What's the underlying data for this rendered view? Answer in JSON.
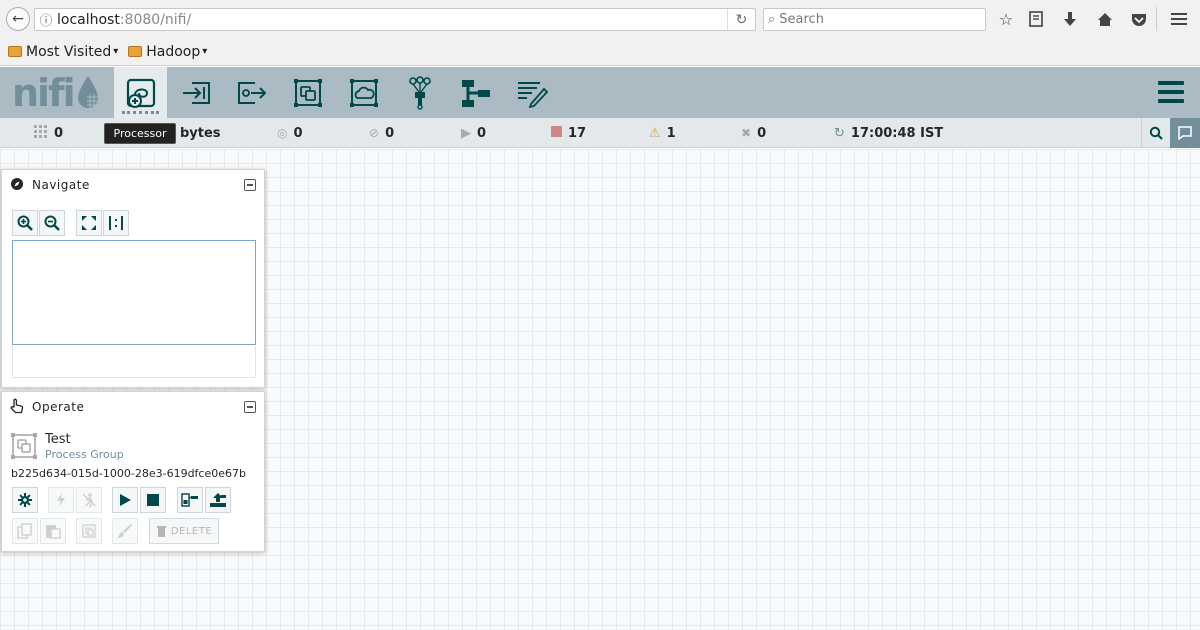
{
  "browser": {
    "url_host": "localhost",
    "url_rest": ":8080/nifi/",
    "search_placeholder": "Search",
    "bookmarks": [
      {
        "label": "Most Visited"
      },
      {
        "label": "Hadoop"
      }
    ]
  },
  "header": {
    "logo": "nifi",
    "tooltip": "Processor",
    "components": [
      {
        "name": "processor-icon"
      },
      {
        "name": "input-port-icon"
      },
      {
        "name": "output-port-icon"
      },
      {
        "name": "process-group-icon"
      },
      {
        "name": "remote-process-group-icon"
      },
      {
        "name": "funnel-icon"
      },
      {
        "name": "template-icon"
      },
      {
        "name": "label-icon"
      }
    ]
  },
  "status": {
    "active_threads": "0",
    "queued": "bytes",
    "transmitting": "0",
    "not_transmitting": "0",
    "running": "0",
    "stopped": "17",
    "invalid": "1",
    "disabled": "0",
    "refreshed": "17:00:48 IST"
  },
  "navigate": {
    "title": "Navigate"
  },
  "operate": {
    "title": "Operate",
    "selection_name": "Test",
    "selection_type": "Process Group",
    "selection_id": "b225d634-015d-1000-28e3-619dfce0e67b",
    "delete_label": "DELETE"
  },
  "colors": {
    "header_bg": "#aabbc3",
    "status_bg": "#e3e8eb",
    "accent": "#004849",
    "stopped": "#d18686",
    "invalid": "#cf9f5d"
  }
}
